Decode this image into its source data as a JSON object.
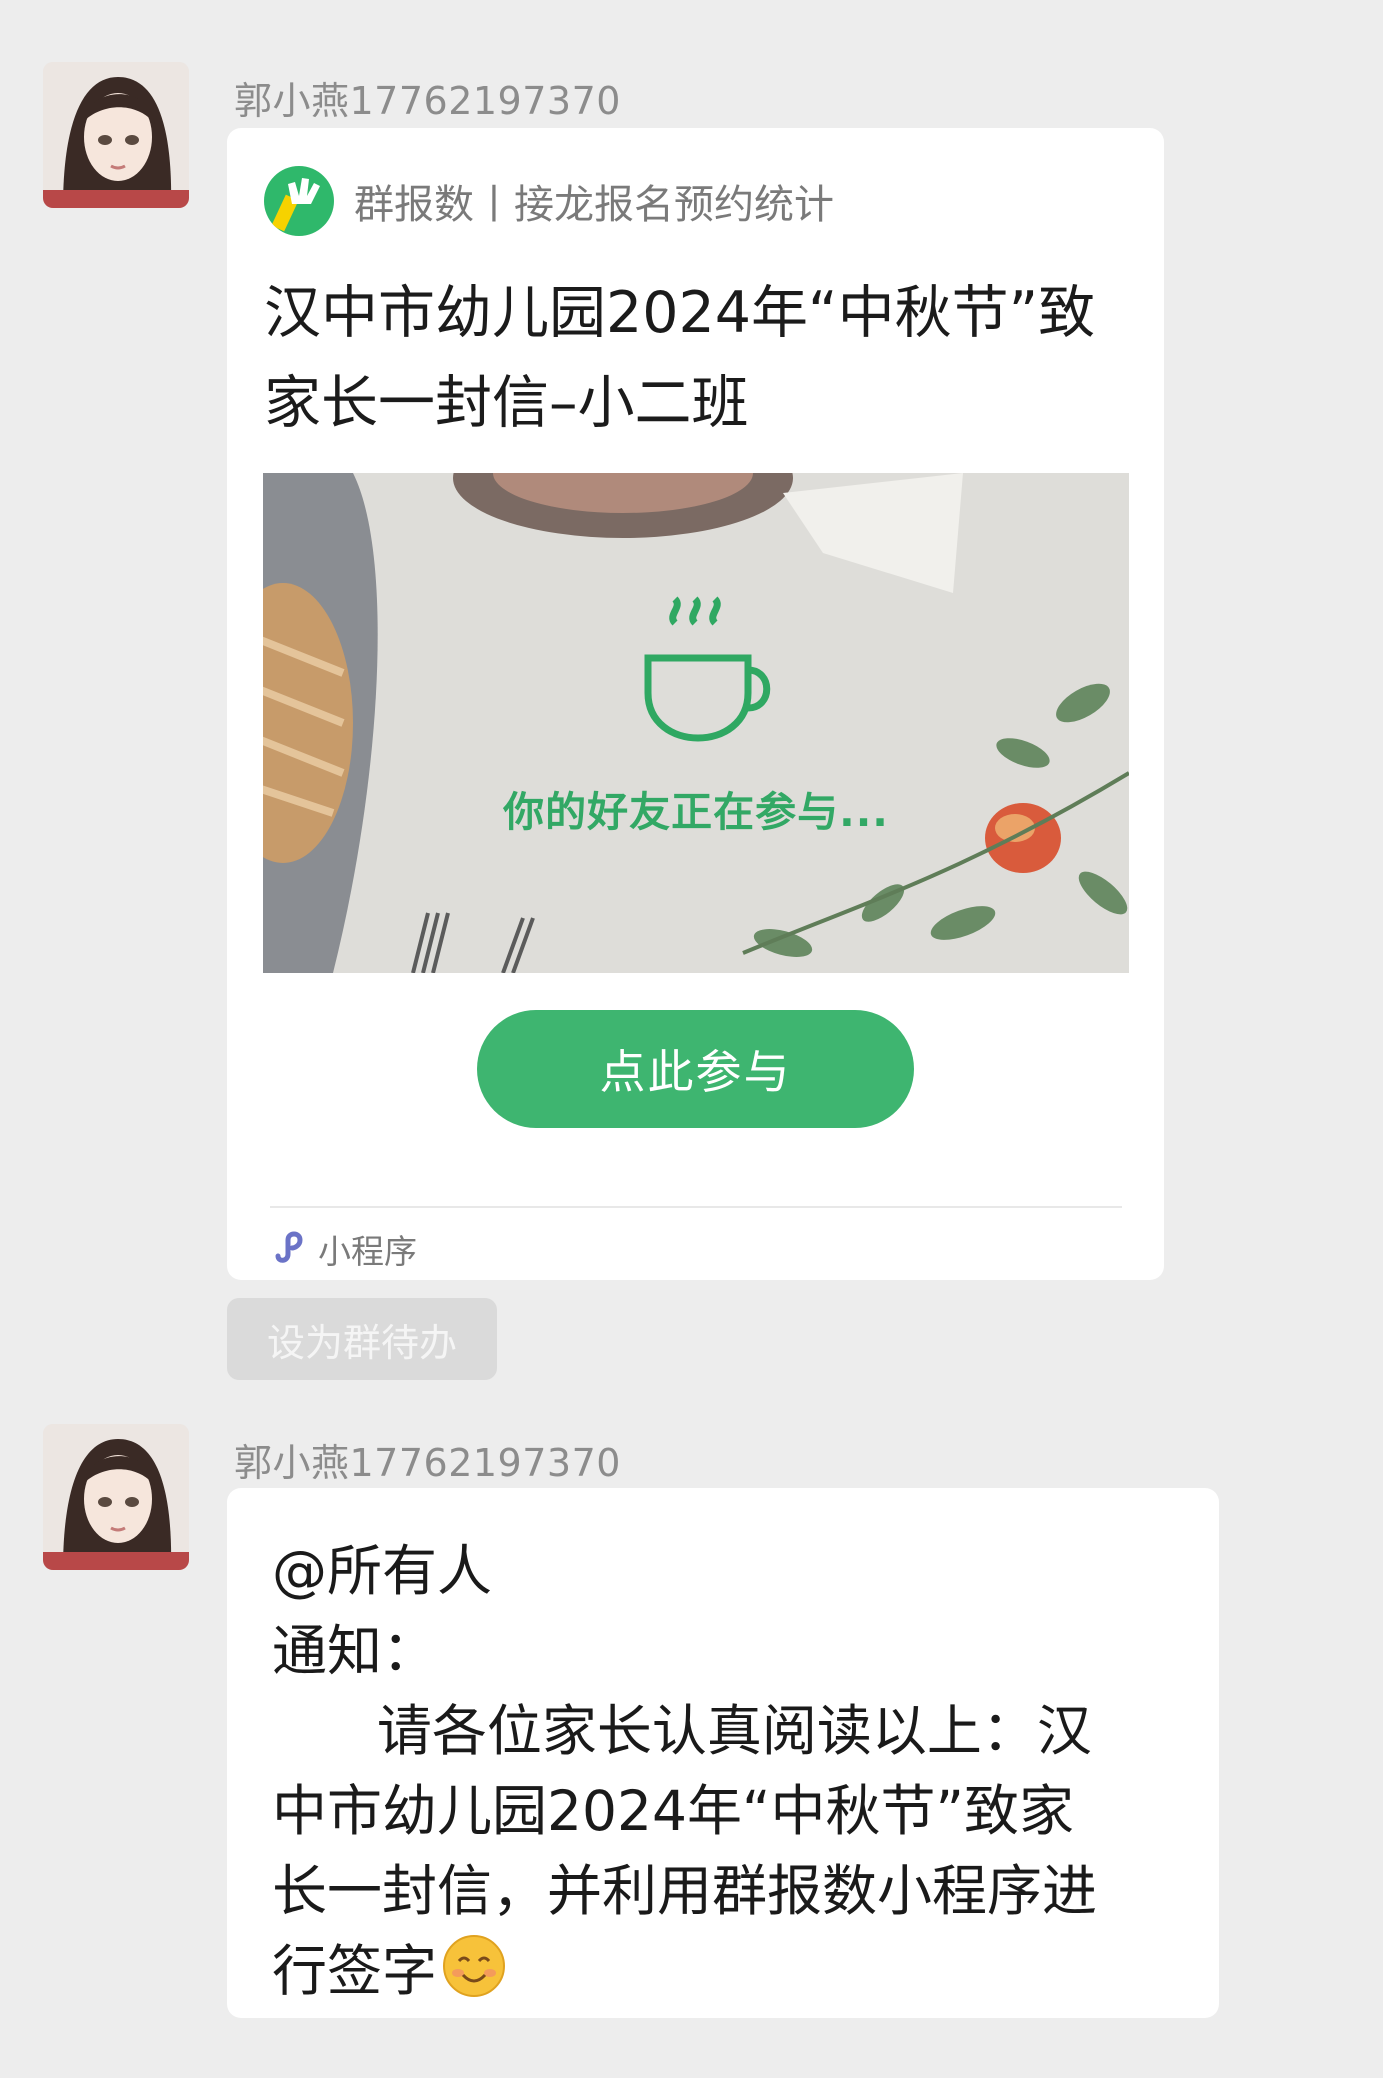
{
  "messages": [
    {
      "sender": "郭小燕17762197370",
      "type": "mini-program-card",
      "app_name": "群报数丨接龙报名预约统计",
      "title_lines": [
        "汉中市幼儿园2024年“中秋节”致",
        "家长一封信–小二班"
      ],
      "preview_text": "你的好友正在参与...",
      "button_label": "点此参与",
      "footer_label": "小程序",
      "action_chip": "设为群待办"
    },
    {
      "sender": "郭小燕17762197370",
      "type": "text",
      "lines": [
        "@所有人",
        "通知：",
        "      请各位家长认真阅读以上：汉",
        "中市幼儿园2024年“中秋节”致家",
        "长一封信，并利用群报数小程序进",
        "行签字"
      ],
      "emoji": "smiling-face-icon"
    }
  ],
  "colors": {
    "background": "#ededed",
    "brand_green": "#3eb570",
    "bubble": "#ffffff"
  }
}
